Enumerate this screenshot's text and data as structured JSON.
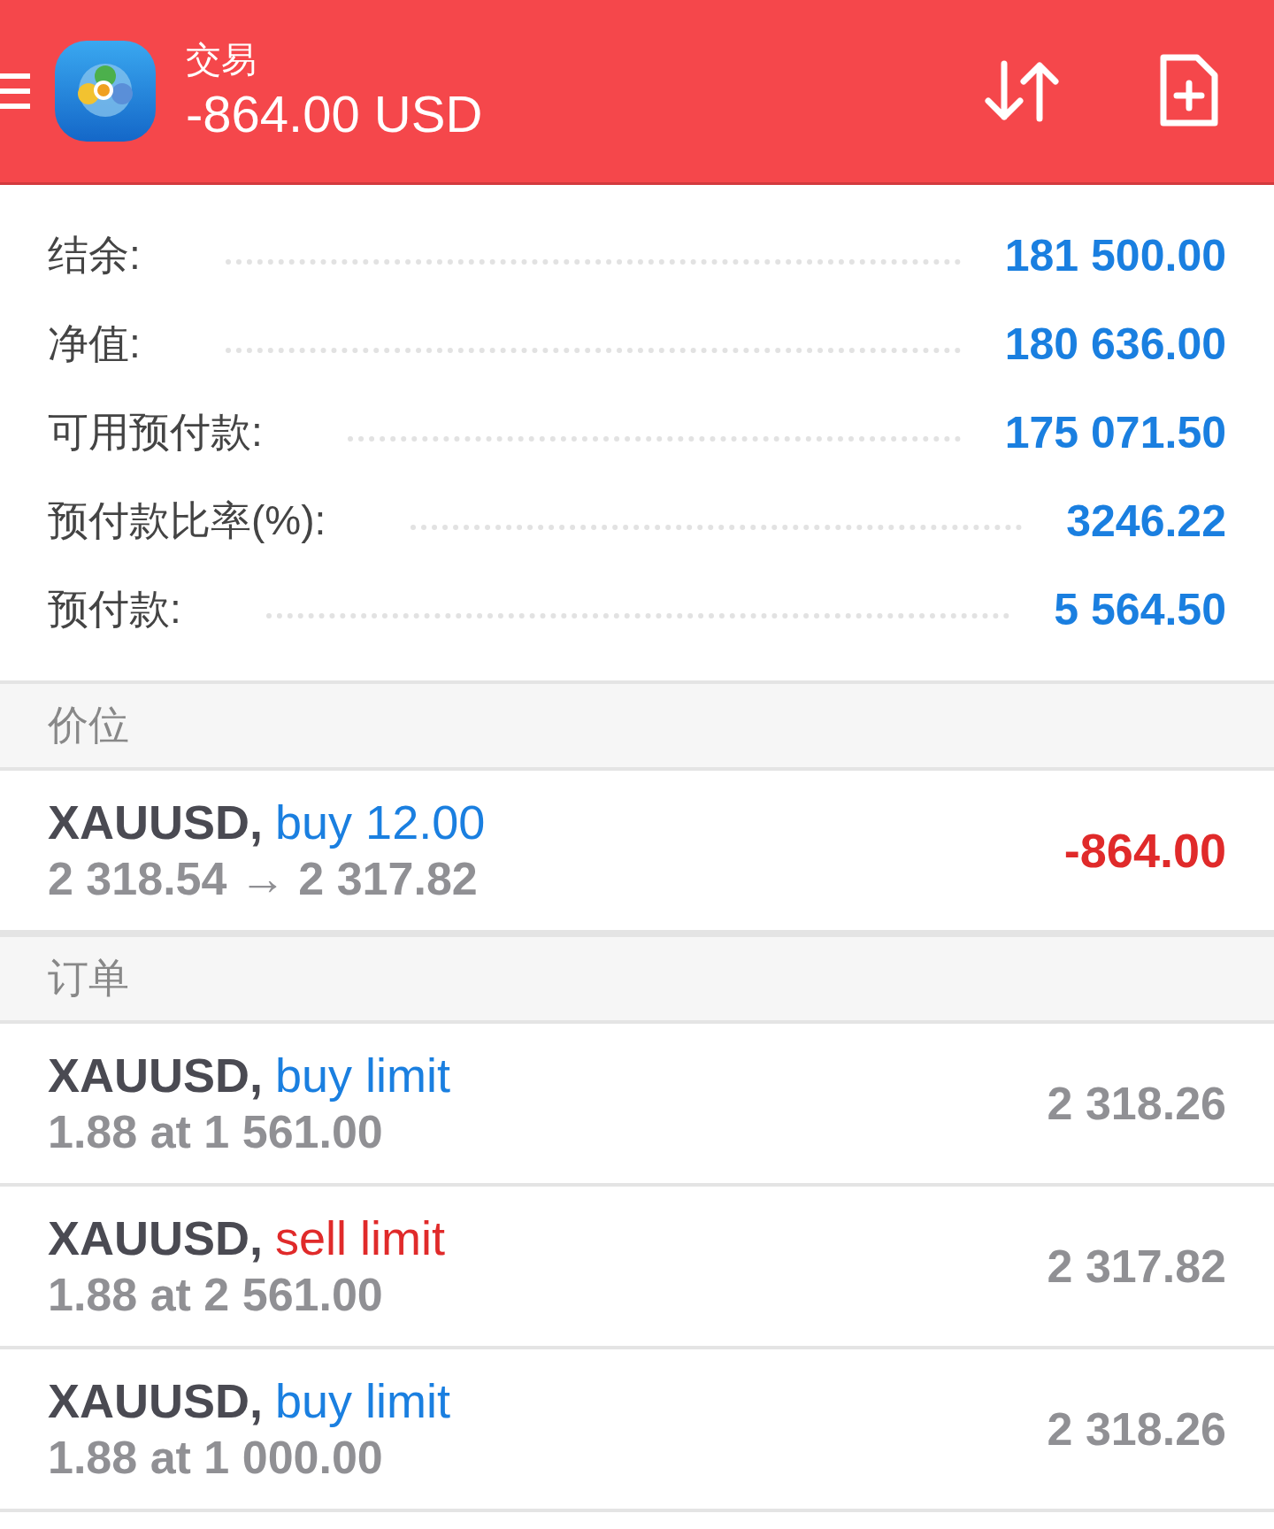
{
  "header": {
    "title": "交易",
    "profit": "-864.00 USD"
  },
  "summary": [
    {
      "label": "结余:",
      "value": "181 500.00"
    },
    {
      "label": "净值:",
      "value": "180 636.00"
    },
    {
      "label": "可用预付款:",
      "value": "175 071.50"
    },
    {
      "label": "预付款比率(%):",
      "value": "3246.22"
    },
    {
      "label": "预付款:",
      "value": "5 564.50"
    }
  ],
  "positions": {
    "heading": "价位",
    "items": [
      {
        "symbol": "XAUUSD,",
        "kind": "buy",
        "type": "buy 12.00",
        "detail": "2 318.54 → 2 317.82",
        "profit": "-864.00"
      }
    ]
  },
  "orders": {
    "heading": "订单",
    "items": [
      {
        "symbol": "XAUUSD,",
        "kind": "buy",
        "type": "buy limit",
        "detail": "1.88 at 1 561.00",
        "price": "2 318.26"
      },
      {
        "symbol": "XAUUSD,",
        "kind": "sell",
        "type": "sell limit",
        "detail": "1.88 at 2 561.00",
        "price": "2 317.82"
      },
      {
        "symbol": "XAUUSD,",
        "kind": "buy",
        "type": "buy limit",
        "detail": "1.88 at 1 000.00",
        "price": "2 318.26"
      }
    ]
  }
}
